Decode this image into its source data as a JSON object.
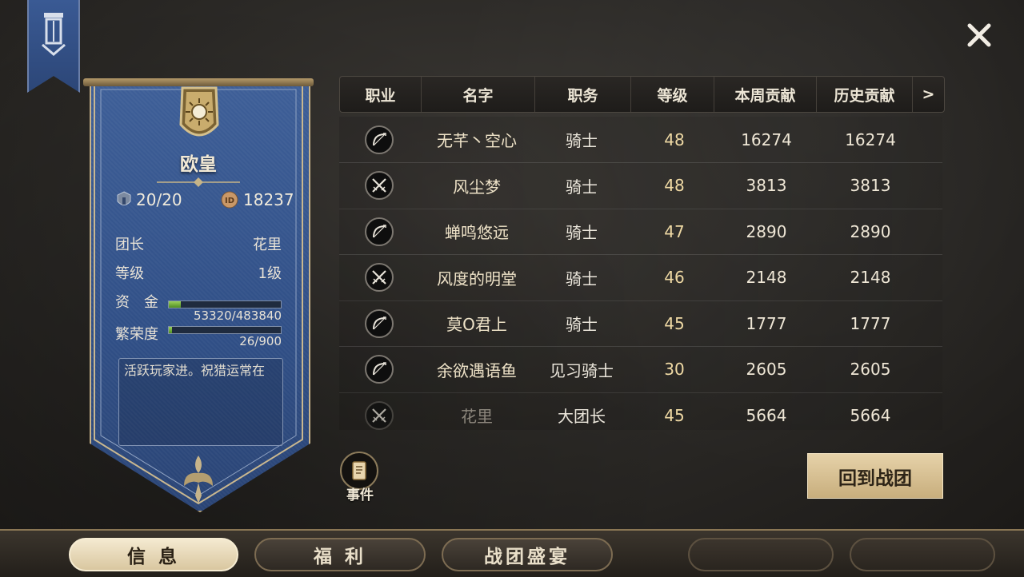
{
  "guild": {
    "name": "欧皇",
    "members": "20/20",
    "id": "18237",
    "leader_label": "团长",
    "leader_value": "花里",
    "level_label": "等级",
    "level_value": "1级",
    "funds_label": "资　金",
    "funds_value": "53320/483840",
    "funds_fraction": 0.11,
    "prosperity_label": "繁荣度",
    "prosperity_value": "26/900",
    "prosperity_fraction": 0.03,
    "notice": "活跃玩家进。祝猎运常在"
  },
  "table": {
    "headers": [
      "职业",
      "名字",
      "职务",
      "等级",
      "本周贡献",
      "历史贡献"
    ],
    "more_arrow": ">",
    "rows": [
      {
        "job_icon": "bow-icon",
        "name": "无芊丶空心",
        "title": "骑士",
        "level": "48",
        "week": "16274",
        "history": "16274"
      },
      {
        "job_icon": "crossed-swords-icon",
        "name": "风尘梦",
        "title": "骑士",
        "level": "48",
        "week": "3813",
        "history": "3813"
      },
      {
        "job_icon": "bow-icon",
        "name": "蝉鸣悠远",
        "title": "骑士",
        "level": "47",
        "week": "2890",
        "history": "2890"
      },
      {
        "job_icon": "crossed-swords-icon",
        "name": "风度的明堂",
        "title": "骑士",
        "level": "46",
        "week": "2148",
        "history": "2148"
      },
      {
        "job_icon": "bow-icon",
        "name": "莫O君上",
        "title": "骑士",
        "level": "45",
        "week": "1777",
        "history": "1777"
      },
      {
        "job_icon": "bow-icon",
        "name": "余欲遇语鱼",
        "title": "见习骑士",
        "level": "30",
        "week": "2605",
        "history": "2605"
      },
      {
        "job_icon": "crossed-swords-icon",
        "name": "花里",
        "title": "大团长",
        "level": "45",
        "week": "5664",
        "history": "5664"
      }
    ]
  },
  "event_label": "事件",
  "return_button": "回到战团",
  "tabs": [
    "信 息",
    "福 利",
    "战团盛宴"
  ],
  "colors": {
    "banner_blue": "#304f86",
    "gold_accent": "#c8ae7d",
    "progress_green": "#6fae35"
  }
}
